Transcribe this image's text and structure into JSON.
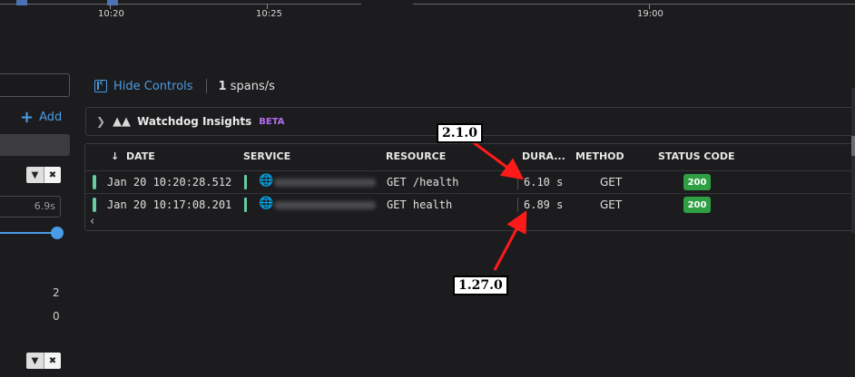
{
  "timeline": {
    "ticks": [
      "10:20",
      "10:25",
      "19:00"
    ]
  },
  "left_panel": {
    "add_label": "Add",
    "duration_value": "6.9s",
    "counts": [
      "2",
      "0"
    ]
  },
  "controls": {
    "hide_controls_label": "Hide Controls",
    "rate_count": "1",
    "rate_unit": "spans/s"
  },
  "insights": {
    "title": "Watchdog Insights",
    "badge": "BETA"
  },
  "table": {
    "headers": {
      "date": "DATE",
      "service": "SERVICE",
      "resource": "RESOURCE",
      "duration": "DURA...",
      "method": "METHOD",
      "status": "STATUS CODE"
    },
    "rows": [
      {
        "date": "Jan 20 10:20:28.512",
        "resource": "GET /health",
        "duration": "6.10 s",
        "method": "GET",
        "status": "200"
      },
      {
        "date": "Jan 20 10:17:08.201",
        "resource": "GET health",
        "duration": "6.89 s",
        "method": "GET",
        "status": "200"
      }
    ]
  },
  "annotations": {
    "top": "2.1.0",
    "bottom": "1.27.0"
  },
  "colors": {
    "accent": "#4a9be6",
    "status_ok": "#2ea043",
    "beta": "#b56cf0",
    "arrow": "#ff1a1a"
  }
}
